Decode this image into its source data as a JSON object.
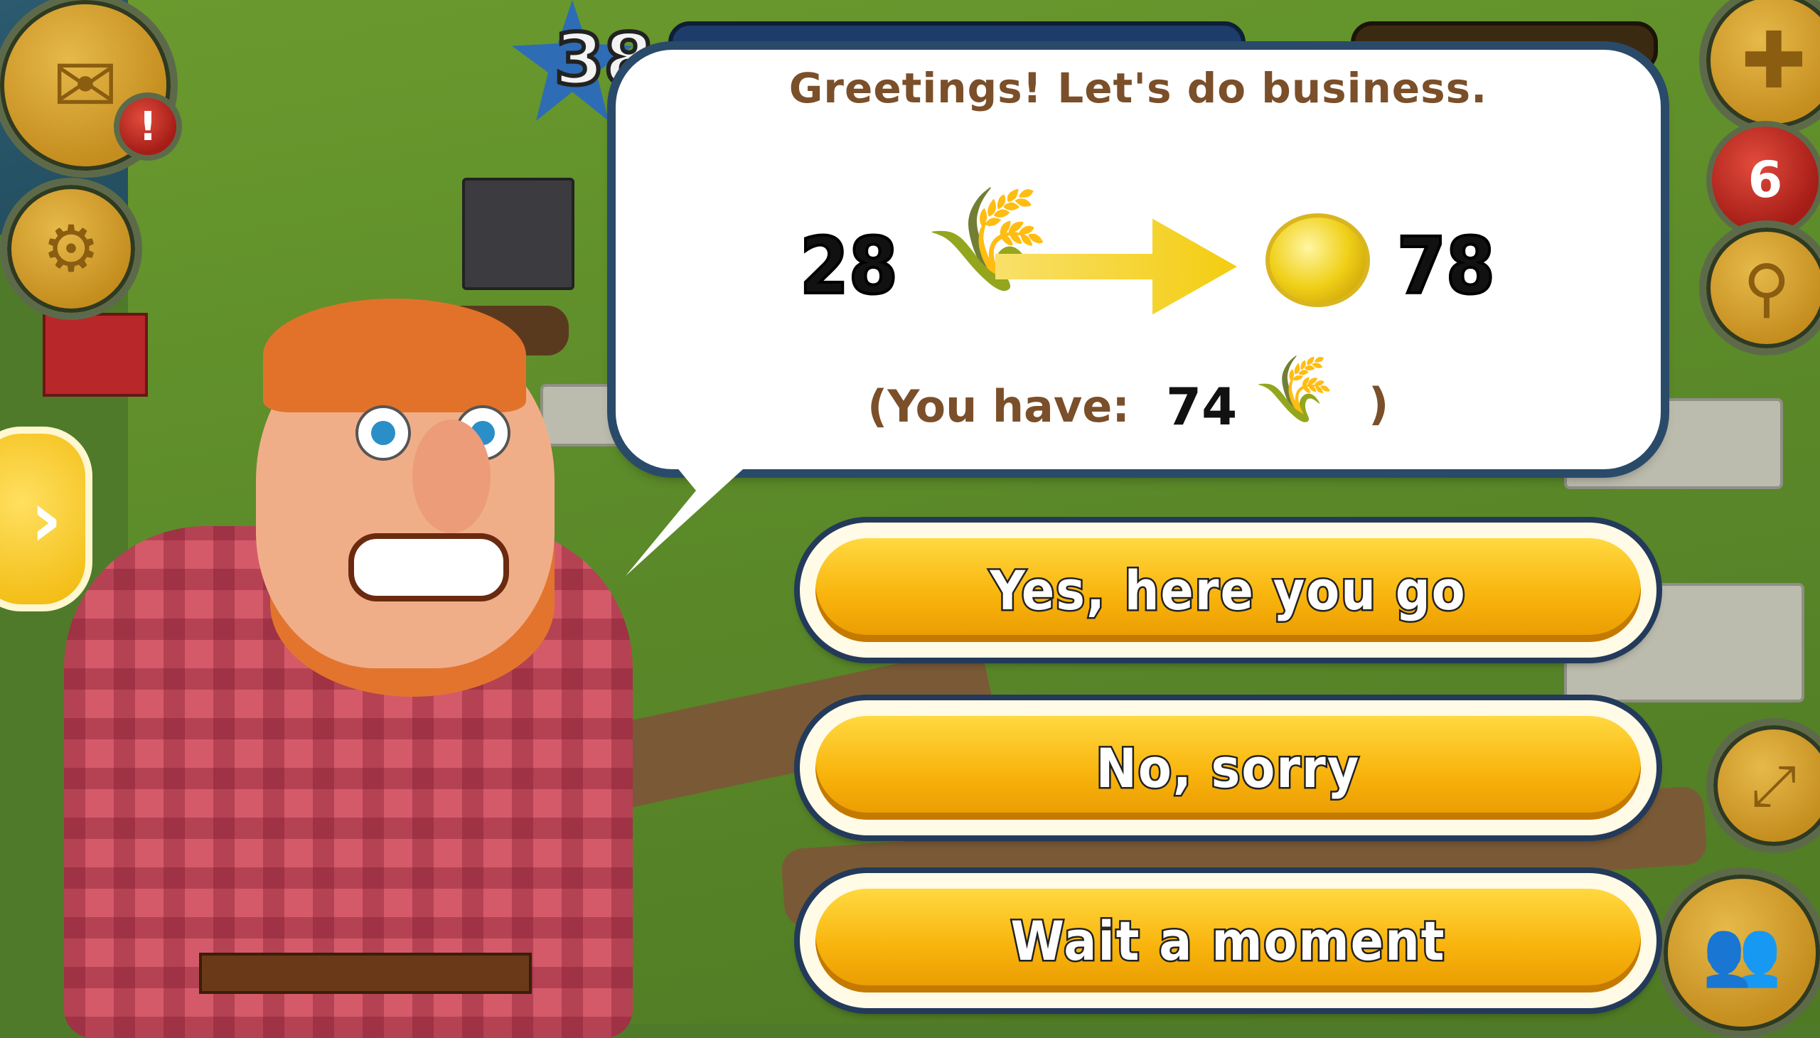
{
  "hud": {
    "level": "38",
    "mail_badge": "!",
    "notification_count": "6"
  },
  "dialog": {
    "greeting": "Greetings! Let's do business.",
    "give_amount": "28",
    "give_item": "wheat-icon",
    "receive_amount": "78",
    "receive_item": "coin-icon",
    "you_have_label": "(You have:",
    "you_have_amount": "74",
    "you_have_close": ")"
  },
  "choices": [
    {
      "label": "Yes, here you go"
    },
    {
      "label": "No, sorry"
    },
    {
      "label": "Wait a moment"
    }
  ],
  "colors": {
    "button_yellow": "#f9b40d",
    "text_brown": "#7a4f2a",
    "bubble_border": "#2a4a6a"
  }
}
